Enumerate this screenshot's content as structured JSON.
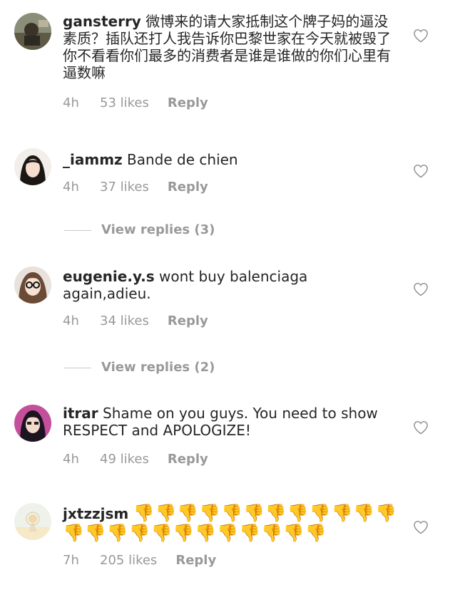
{
  "comments": [
    {
      "username": "gansterry",
      "text": "微博来的请大家抵制这个牌子妈的逼没素质？插队还打人我告诉你巴黎世家在今天就被毁了你不看看你们最多的消费者是谁是谁做的你们心里有逼数嘛",
      "time": "4h",
      "likes": "53 likes",
      "reply": "Reply"
    },
    {
      "username": "_iammz",
      "text": "Bande de chien",
      "time": "4h",
      "likes": "37 likes",
      "reply": "Reply",
      "view_replies": "View replies (3)"
    },
    {
      "username": "eugenie.y.s",
      "text": "wont buy balenciaga again,adieu.",
      "time": "4h",
      "likes": "34 likes",
      "reply": "Reply",
      "view_replies": "View replies (2)"
    },
    {
      "username": "itrar",
      "text": "Shame on you guys. You need to show RESPECT and APOLOGIZE!",
      "time": "4h",
      "likes": "49 likes",
      "reply": "Reply"
    },
    {
      "username": "jxtzzjsm",
      "text": "👎👎👎👎👎👎👎👎👎👎👎👎👎👎👎👎👎👎👎👎👎👎👎👎",
      "time": "7h",
      "likes": "205 likes",
      "reply": "Reply"
    }
  ],
  "icons": {
    "like": "heart-outline-icon"
  }
}
